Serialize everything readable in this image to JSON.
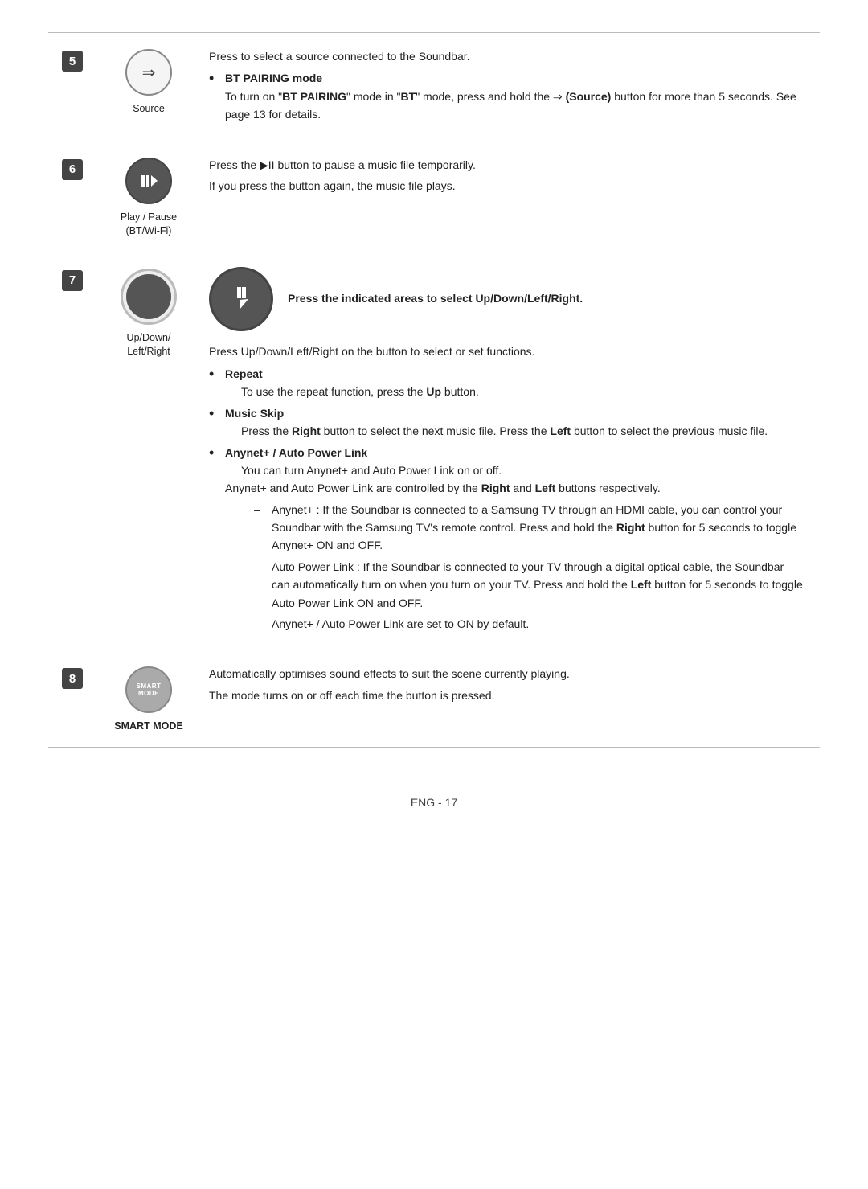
{
  "rows": [
    {
      "num": "5",
      "icon_label": "Source",
      "description": {
        "main": "Press to select a source connected to the Soundbar.",
        "bullets": [
          {
            "label": "BT PAIRING mode",
            "text_pre": "To turn on \"",
            "text_bold1": "BT PAIRING",
            "text_mid1": "\" mode in \"",
            "text_bold2": "BT",
            "text_mid2": "\" mode, press and hold the ",
            "text_source": "(Source)",
            "text_end": " button for more than 5 seconds. See page 13 for details."
          }
        ]
      }
    },
    {
      "num": "6",
      "icon_label": "Play / Pause\n(BT/Wi-Fi)",
      "description": {
        "main_line1": "Press the ▶II button to pause a music file temporarily.",
        "main_line2": "If you press the button again, the music file plays."
      }
    },
    {
      "num": "7",
      "icon_label": "Up/Down/\nLeft/Right",
      "description": {
        "indicated_areas": "Press the indicated areas to select Up/Down/Left/Right.",
        "main": "Press Up/Down/Left/Right on the button to select or set functions.",
        "bullets": [
          {
            "label": "Repeat",
            "text": "To use the repeat function, press the ",
            "text_bold": "Up",
            "text_end": " button."
          },
          {
            "label": "Music Skip",
            "text_pre": "Press the ",
            "text_bold1": "Right",
            "text_mid": " button to select the next music file. Press the ",
            "text_bold2": "Left",
            "text_end": " button to select the previous music file."
          },
          {
            "label": "Anynet+ / Auto Power Link",
            "text": "You can turn Anynet+ and Auto Power Link on or off.",
            "text2_pre": "Anynet+ and Auto Power Link are controlled by the ",
            "text2_bold1": "Right",
            "text2_mid": " and ",
            "text2_bold2": "Left",
            "text2_end": " buttons respectively.",
            "sub_bullets": [
              "Anynet+ : If the Soundbar is connected to a Samsung TV through an HDMI cable, you can control your Soundbar with the Samsung TV's remote control. Press and hold the Right button for 5 seconds to toggle Anynet+ ON and OFF.",
              "Auto Power Link : If the Soundbar is connected to your TV through a digital optical cable, the Soundbar can automatically turn on when you turn on your TV. Press and hold the Left button for 5 seconds to toggle Auto Power Link ON and OFF.",
              "Anynet+ / Auto Power Link are set to ON by default."
            ]
          }
        ]
      }
    },
    {
      "num": "8",
      "icon_label": "SMART MODE",
      "description": {
        "main_line1": "Automatically optimises sound effects to suit the scene currently playing.",
        "main_line2": "The mode turns on or off each time the button is pressed."
      }
    }
  ],
  "footer": "ENG - 17"
}
